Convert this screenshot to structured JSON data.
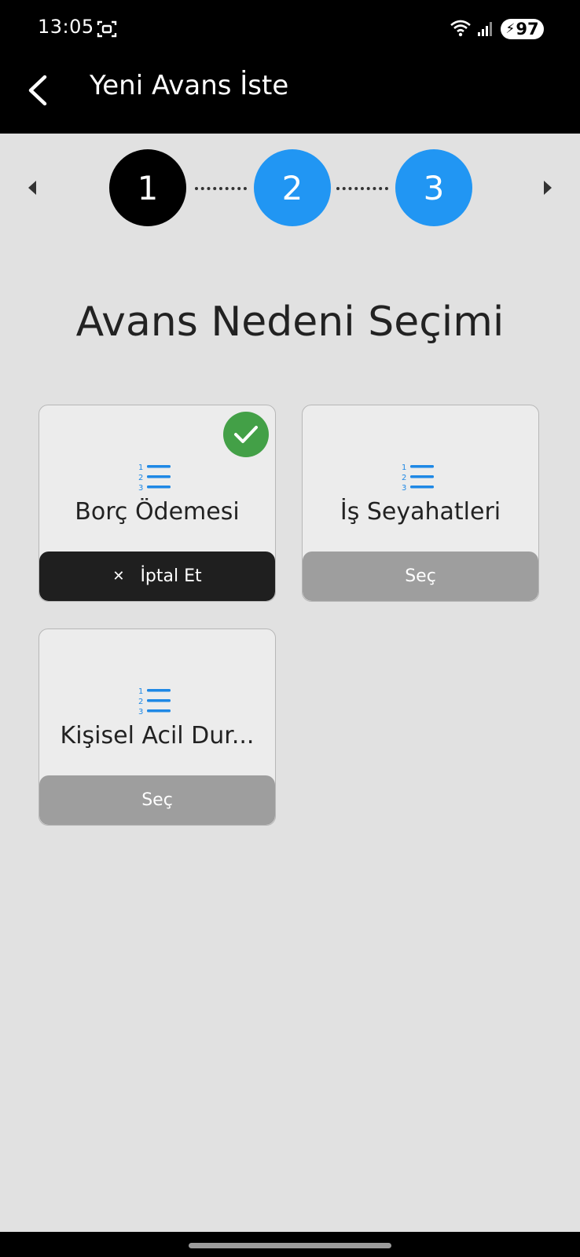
{
  "status_bar": {
    "time": "13:05",
    "battery_level": "97",
    "icons": [
      "screenshot-icon",
      "wifi-icon",
      "signal-icon",
      "battery-charging-icon"
    ]
  },
  "app_bar": {
    "title": "Yeni Avans İste",
    "back_icon": "chevron-left-icon"
  },
  "stepper": {
    "steps": [
      {
        "label": "1",
        "state": "active",
        "color": "#000000"
      },
      {
        "label": "2",
        "state": "inactive",
        "color": "#2196f3"
      },
      {
        "label": "3",
        "state": "inactive",
        "color": "#2196f3"
      }
    ],
    "prev_icon": "triangle-left-icon",
    "next_icon": "triangle-right-icon"
  },
  "section": {
    "title": "Avans Nedeni Seçimi"
  },
  "options": [
    {
      "label": "Borç Ödemesi",
      "selected": true,
      "action_label": "İptal Et",
      "action_icon": "close-icon",
      "icon": "numbered-list-icon"
    },
    {
      "label": "İş Seyahatleri",
      "selected": false,
      "action_label": "Seç",
      "icon": "numbered-list-icon"
    },
    {
      "label": "Kişisel Acil Dur...",
      "selected": false,
      "action_label": "Seç",
      "icon": "numbered-list-icon"
    }
  ],
  "colors": {
    "background": "#e1e1e1",
    "accent": "#2196f3",
    "selected_check": "#43a047",
    "select_button": "#9e9e9e",
    "cancel_button": "#1f1f1f"
  }
}
